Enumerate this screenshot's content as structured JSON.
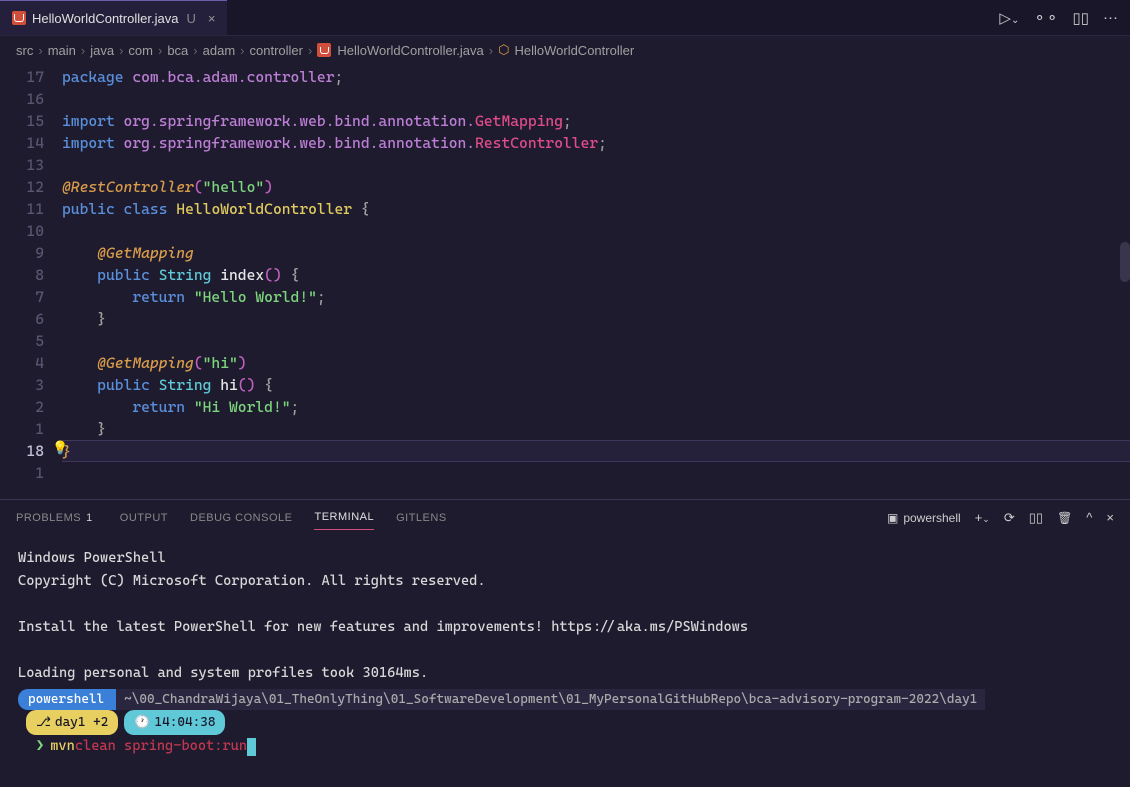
{
  "tab": {
    "filename": "HelloWorldController.java",
    "modified_flag": "U",
    "close_glyph": "×"
  },
  "tab_actions": {
    "run": "▷",
    "run_drop": "⌄",
    "branch": "⚬⚬",
    "split": "▯▯",
    "more": "···"
  },
  "breadcrumb": {
    "items": [
      "src",
      "main",
      "java",
      "com",
      "bca",
      "adam",
      "controller"
    ],
    "file": "HelloWorldController.java",
    "symbol": "HelloWorldController",
    "sep": "›"
  },
  "gutter": [
    "17",
    "16",
    "15",
    "14",
    "13",
    "12",
    "11",
    "10",
    "9",
    "8",
    "7",
    "6",
    "5",
    "4",
    "3",
    "2",
    "1",
    "18",
    "1"
  ],
  "active_line_index": 17,
  "code": {
    "package_kw": "package",
    "package_path": "com.bca.adam.controller",
    "import_kw": "import",
    "import1_ns": "org.springframework.web.bind.annotation.",
    "import1_sym": "GetMapping",
    "import2_ns": "org.springframework.web.bind.annotation.",
    "import2_sym": "RestController",
    "annot_restcontroller": "@RestController",
    "restcontroller_arg": "\"hello\"",
    "public_kw": "public",
    "class_kw": "class",
    "class_name": "HelloWorldController",
    "annot_getmapping": "@GetMapping",
    "string_type": "String",
    "method_index": "index",
    "return_kw": "return",
    "str_hello": "\"Hello World!\"",
    "getmapping_arg": "\"hi\"",
    "method_hi": "hi",
    "str_hi": "\"Hi World!\"",
    "brace_open": "{",
    "brace_close": "}",
    "semi": ";",
    "at": "@",
    "paren_open": "(",
    "paren_close": ")"
  },
  "panel_tabs": {
    "problems": "PROBLEMS",
    "problems_count": "1",
    "output": "OUTPUT",
    "debug": "DEBUG CONSOLE",
    "terminal": "TERMINAL",
    "gitlens": "GITLENS"
  },
  "panel_right": {
    "shell_label": "powershell",
    "plus": "+",
    "caret": "⌄",
    "refresh": "⟳",
    "split": "▯▯",
    "trash": "🗑",
    "up": "^",
    "close": "×"
  },
  "terminal": {
    "l1": "Windows PowerShell",
    "l2": "Copyright (C) Microsoft Corporation. All rights reserved.",
    "l3": "Install the latest PowerShell for new features and improvements! https://aka.ms/PSWindows",
    "l4": "Loading personal and system profiles took 30164ms.",
    "seg_shell": "powershell",
    "seg_path": " ~\\00_ChandraWijaya\\01_TheOnlyThing\\01_SoftwareDevelopment\\01_MyPersonalGitHubRepo\\bca-advisory-program-2022\\day1",
    "branch_label": "day1 +2",
    "time_label": "14:04:38",
    "cmd_prefix": "mvn",
    "cmd_rest": " clean spring-boot:run"
  }
}
